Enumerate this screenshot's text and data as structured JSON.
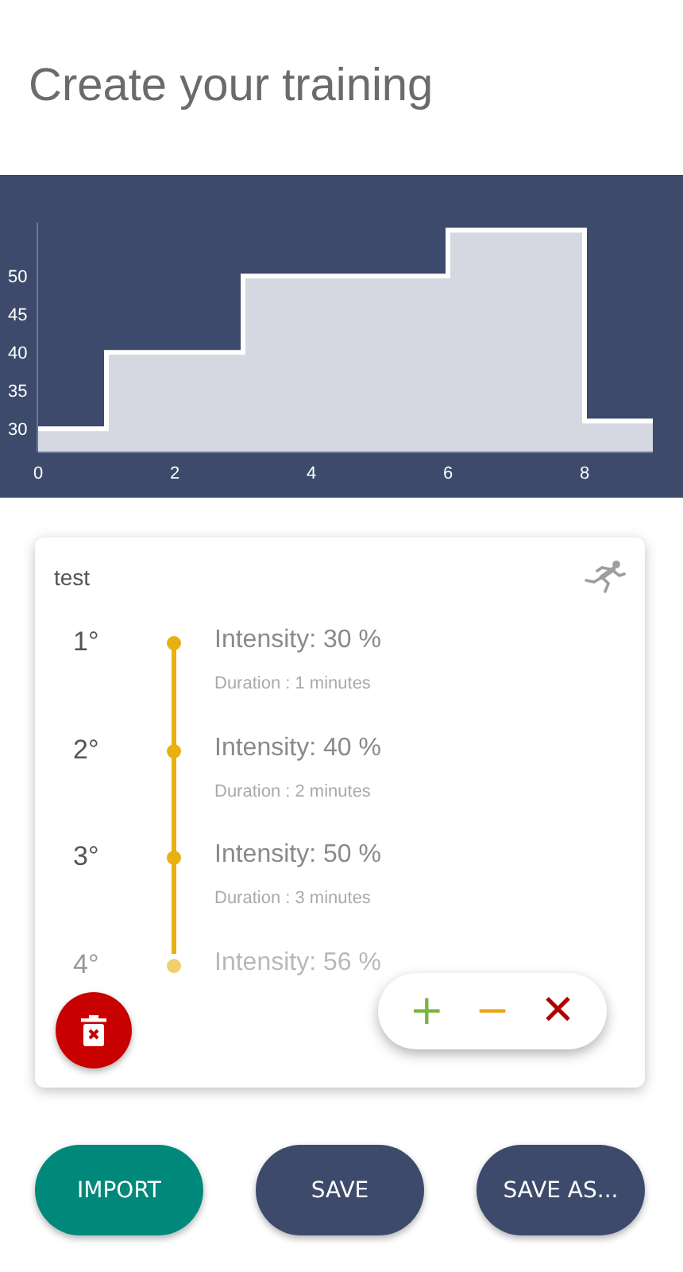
{
  "title": "Create your training",
  "chart_data": {
    "type": "area",
    "x": [
      0,
      1,
      1,
      3,
      3,
      6,
      6,
      8,
      8,
      9
    ],
    "series": [
      {
        "color": "#d5d8e0",
        "values": [
          30,
          30,
          40,
          40,
          50,
          50,
          56,
          56,
          31,
          31
        ]
      }
    ],
    "xlim": [
      0,
      9
    ],
    "ylim": [
      27,
      57
    ],
    "xticks": [
      0,
      2,
      4,
      6,
      8
    ],
    "yticks": [
      30,
      35,
      40,
      45,
      50
    ]
  },
  "card": {
    "name": "test",
    "steps": [
      {
        "number": "1°",
        "intensity": "Intensity: 30 %",
        "duration": "Duration : 1 minutes",
        "faded": false
      },
      {
        "number": "2°",
        "intensity": "Intensity: 40 %",
        "duration": "Duration : 2 minutes",
        "faded": false
      },
      {
        "number": "3°",
        "intensity": "Intensity: 50 %",
        "duration": "Duration : 3 minutes",
        "faded": false
      },
      {
        "number": "4°",
        "intensity": "Intensity: 56 %",
        "faded": true
      }
    ],
    "controls": [
      {
        "kind": "add",
        "label": "+"
      },
      {
        "kind": "remove",
        "label": "−"
      },
      {
        "kind": "close",
        "label": "✕"
      }
    ]
  },
  "buttons": [
    {
      "label": "IMPORT",
      "kind": "primary"
    },
    {
      "label": "SAVE",
      "kind": "secondary"
    },
    {
      "label": "SAVE AS...",
      "kind": "secondary"
    }
  ]
}
